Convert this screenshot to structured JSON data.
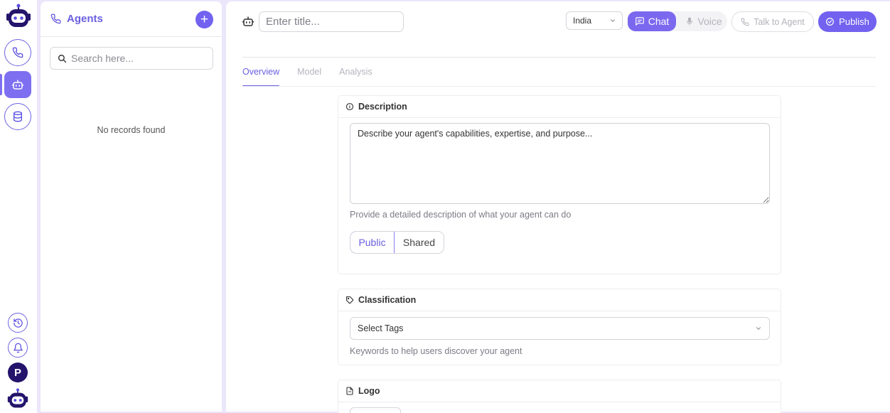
{
  "sidebar": {
    "items": [
      {
        "name": "calls",
        "icon": "phone-icon"
      },
      {
        "name": "agents",
        "icon": "robot-icon",
        "active": true
      },
      {
        "name": "knowledge-base",
        "icon": "database-icon"
      }
    ],
    "bottom": {
      "history_icon": "history-icon",
      "notifications_icon": "bell-icon",
      "avatar_initial": "P"
    }
  },
  "agents_panel": {
    "title": "Agents",
    "search_placeholder": "Search here...",
    "empty_text": "No records found"
  },
  "header": {
    "title_placeholder": "Enter title...",
    "country": "India",
    "mode": {
      "chat": "Chat",
      "voice": "Voice",
      "selected": "chat"
    },
    "talk_to_agent": "Talk to Agent",
    "publish": "Publish"
  },
  "tabs": [
    {
      "label": "Overview",
      "active": true
    },
    {
      "label": "Model",
      "active": false
    },
    {
      "label": "Analysis",
      "active": false
    }
  ],
  "description_card": {
    "title": "Description",
    "placeholder": "Describe your agent's capabilities, expertise, and purpose...",
    "helper": "Provide a detailed description of what your agent can do",
    "visibility": {
      "options": [
        "Public",
        "Shared"
      ],
      "selected": "Public"
    }
  },
  "classification_card": {
    "title": "Classification",
    "select_label": "Select Tags",
    "helper": "Keywords to help users discover your agent"
  },
  "logo_card": {
    "title": "Logo"
  },
  "colors": {
    "accent": "#7262ef",
    "accent_text": "#6a5fe0",
    "background": "#ece6fb",
    "avatar": "#24146b"
  }
}
